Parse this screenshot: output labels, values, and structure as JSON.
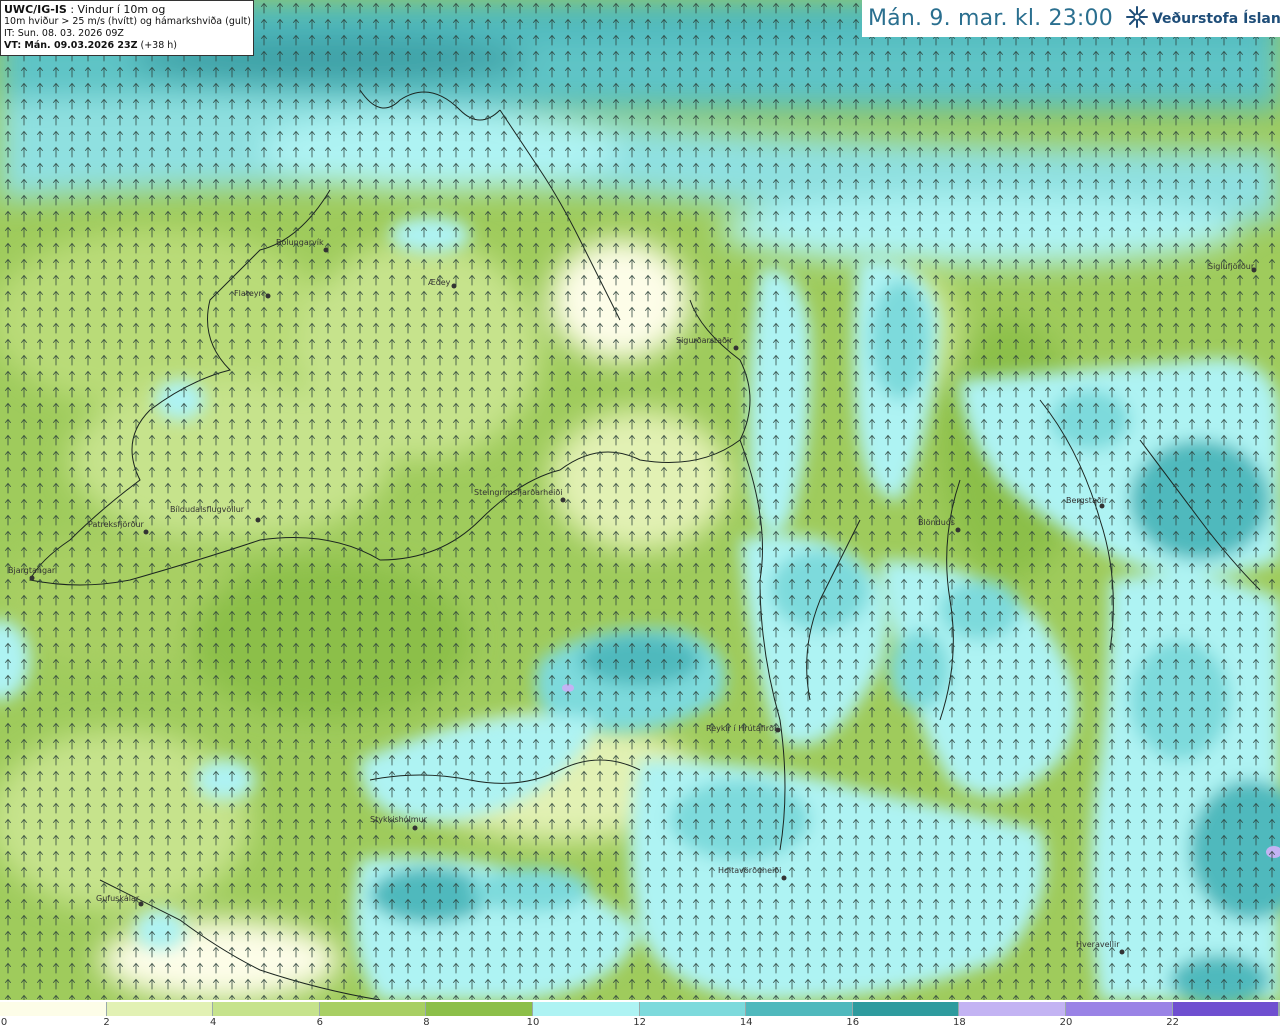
{
  "info": {
    "model": "UWC/IG-IS",
    "title_suffix": " : Vindur í 10m og",
    "line2": "10m hviður > 25 m/s (hvítt) og hámarkshviða (gult)",
    "it_line": "IT: Sun. 08. 03. 2026 09Z",
    "vt_bold": "VT: Mán. 09.03.2026 23Z",
    "vt_suffix": " (+38 h)"
  },
  "header": {
    "time": "Mán. 9. mar. kl. 23:00",
    "org": "Veðurstofa Íslands",
    "logo_icon": "vedurstofa-logo-icon"
  },
  "legend": {
    "colors": [
      "#fdfde8",
      "#e2f1b4",
      "#c6e38c",
      "#a8cf63",
      "#8cbf48",
      "#aef3f3",
      "#7ddadc",
      "#4fb9bd",
      "#2e9b9e",
      "#c3b3f3",
      "#9a83e6",
      "#6f4fd0",
      "#4629a8"
    ],
    "labels": [
      "0",
      "2",
      "4",
      "6",
      "8",
      "10",
      "12",
      "14",
      "16",
      "18",
      "20",
      "22"
    ]
  },
  "places": [
    {
      "name": "Bolungarvík"
    },
    {
      "name": "Flateyri"
    },
    {
      "name": "Æðey"
    },
    {
      "name": "Sigurðarstaðir"
    },
    {
      "name": "Siglufjörður"
    },
    {
      "name": "Steingrímsfjarðarheiði"
    },
    {
      "name": "Patreksfjörður"
    },
    {
      "name": "Bíldudalsflugvöllur"
    },
    {
      "name": "Bjargtangar"
    },
    {
      "name": "Blönduós"
    },
    {
      "name": "Bergstaðir"
    },
    {
      "name": "Reykir í Hrútafirði"
    },
    {
      "name": "Stykkishólmur"
    },
    {
      "name": "Holtavörðuheiði"
    },
    {
      "name": "Gufuskálar"
    },
    {
      "name": "Hveravellir"
    }
  ]
}
